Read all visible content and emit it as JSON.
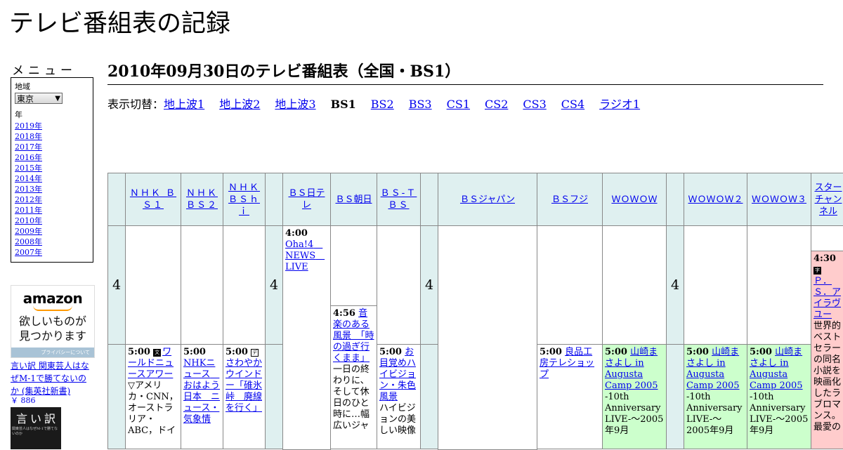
{
  "site": {
    "title": "テレビ番組表の記録"
  },
  "menu": {
    "label": "メニュー",
    "region_label": "地域",
    "region_value": "東京",
    "year_label": "年",
    "years": [
      "2019年",
      "2018年",
      "2017年",
      "2016年",
      "2015年",
      "2014年",
      "2013年",
      "2012年",
      "2011年",
      "2010年",
      "2009年",
      "2008年",
      "2007年"
    ]
  },
  "ad": {
    "brand": "amazon",
    "line1": "欲しいものが",
    "line2": "見つかります",
    "privacy": "プライバシーについて"
  },
  "book": {
    "title": "言い訳 関東芸人はなぜM-1で勝てないのか (集英社新書)",
    "price": "￥ 886",
    "cover_text": "言い訳",
    "cover_sub": "関東芸人はなぜM-1で勝てないのか"
  },
  "page": {
    "heading": "2010年09月30日のテレビ番組表（全国・BS1）"
  },
  "switcher": {
    "label": "表示切替：",
    "items": [
      {
        "text": "地上波1",
        "current": false
      },
      {
        "text": "地上波2",
        "current": false
      },
      {
        "text": "地上波3",
        "current": false
      },
      {
        "text": "BS1",
        "current": true
      },
      {
        "text": "BS2",
        "current": false
      },
      {
        "text": "BS3",
        "current": false
      },
      {
        "text": "CS1",
        "current": false
      },
      {
        "text": "CS2",
        "current": false
      },
      {
        "text": "CS3",
        "current": false
      },
      {
        "text": "CS4",
        "current": false
      },
      {
        "text": "ラジオ1",
        "current": false
      }
    ]
  },
  "schedule": {
    "hour": "4",
    "channels": {
      "nhk_bs1": "ＮＨＫ ＢＳ１",
      "nhk_bs2": "ＮＨＫ ＢＳ２",
      "nhk_bshi": "ＮＨＫ ＢＳｈｉ",
      "bs_ntv": "ＢＳ日テレ",
      "bs_asahi": "ＢＳ朝日",
      "bs_tbs": "ＢＳ-ＴＢＳ",
      "bs_japan": "ＢＳジャパン",
      "bs_fuji": "ＢＳフジ",
      "wowow": "ＷＯＷＯＷ",
      "wowow2": "ＷＯＷＯＷ２",
      "wowow3": "ＷＯＷＯＷ３",
      "star": "スターチャンネル"
    },
    "programs": {
      "ntv_0400": {
        "time": "4:00",
        "title": "Oha!4　NEWS　LIVE"
      },
      "asahi_0456": {
        "time": "4:56",
        "title": "音楽のある風景　「時の過ぎ行くまま」",
        "desc": "一日の終わりに、そして休日のひと時に…幅広いジャ"
      },
      "star_0430": {
        "time": "4:30",
        "mark": "字",
        "title": "Ｐ．Ｓ．アイラヴユー",
        "desc": "世界的ベストセラーの同名小説を映画化したラブロマンス。最愛の"
      },
      "bs1_0500": {
        "time": "5:00",
        "mark": "文",
        "title": "ワールドニュースアワー",
        "desc": "▽アメリカ・CNN，オーストラリア・ABC，ドイ"
      },
      "bs2_0500": {
        "time": "5:00",
        "title": "NHKニュース　おはよう日本　ニュース・気象情"
      },
      "hi_0500": {
        "time": "5:00",
        "mark": "デ",
        "title": "さわやかウインドー「碓氷峠　廃線を行く」"
      },
      "tbs_0500": {
        "time": "5:00",
        "title": "お目覚めハイビジョン・朱色風景",
        "desc": "ハイビジョンの美しい映像"
      },
      "fuji_0500": {
        "time": "5:00",
        "title": "良品工房テレショップ"
      },
      "wowow_0500": {
        "time": "5:00",
        "title": "山崎まさよし in Augusta Camp 2005",
        "desc": "-10th Anniversary LIVE-～2005年9月"
      },
      "wowow2_0500": {
        "time": "5:00",
        "title": "山崎まさよし in Augusta Camp 2005",
        "desc": "-10th Anniversary LIVE-～2005年9月"
      },
      "wowow3_0500": {
        "time": "5:00",
        "title": "山崎まさよし in Augusta Camp 2005",
        "desc": "-10th Anniversary LIVE-～2005年9月"
      }
    }
  }
}
